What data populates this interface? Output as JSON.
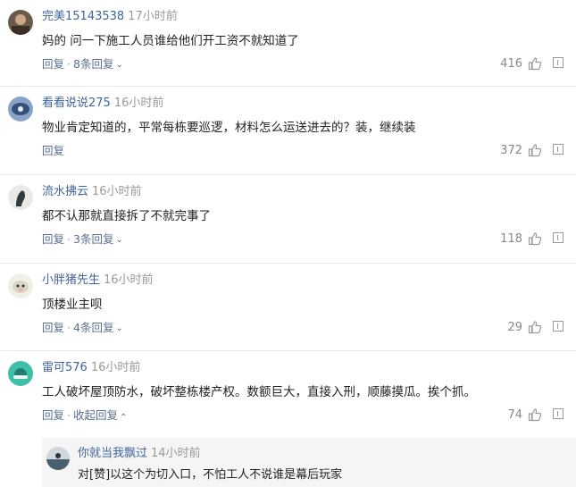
{
  "comments": [
    {
      "user": "完美15143538",
      "time": "17小时前",
      "text": "妈的 问一下施工人员谁给他们开工资不就知道了",
      "reply": "回复",
      "sep": "·",
      "sub": "8条回复",
      "likes": "416",
      "chev": "down"
    },
    {
      "user": "看看说说275",
      "time": "16小时前",
      "text": "物业肯定知道的，平常每栋要巡逻，材料怎么运送进去的？装，继续装",
      "reply": "回复",
      "sep": "",
      "sub": "",
      "likes": "372",
      "chev": ""
    },
    {
      "user": "流水拂云",
      "time": "16小时前",
      "text": "都不认那就直接拆了不就完事了",
      "reply": "回复",
      "sep": "·",
      "sub": "3条回复",
      "likes": "118",
      "chev": "down"
    },
    {
      "user": "小胖猪先生",
      "time": "16小时前",
      "text": "顶楼业主呗",
      "reply": "回复",
      "sep": "·",
      "sub": "4条回复",
      "likes": "29",
      "chev": "down"
    },
    {
      "user": "雷可576",
      "time": "16小时前",
      "text": "工人破坏屋顶防水，破坏整栋楼产权。数额巨大，直接入刑，顺藤摸瓜。挨个抓。",
      "reply": "回复",
      "sep": "·",
      "sub": "收起回复",
      "likes": "74",
      "chev": "up"
    }
  ],
  "nested_reply": {
    "user": "你就当我飘过",
    "time": "14小时前",
    "text": "对[赞]以这个为切入口，不怕工人不说谁是幕后玩家"
  },
  "icons": {
    "like": "thumb-up-icon",
    "report": "report-icon",
    "chevron_down": "chevron-down-icon",
    "chevron_up": "chevron-up-icon"
  },
  "colors": {
    "username": "#406599",
    "meta": "#999999",
    "action": "#5a6e8e"
  }
}
